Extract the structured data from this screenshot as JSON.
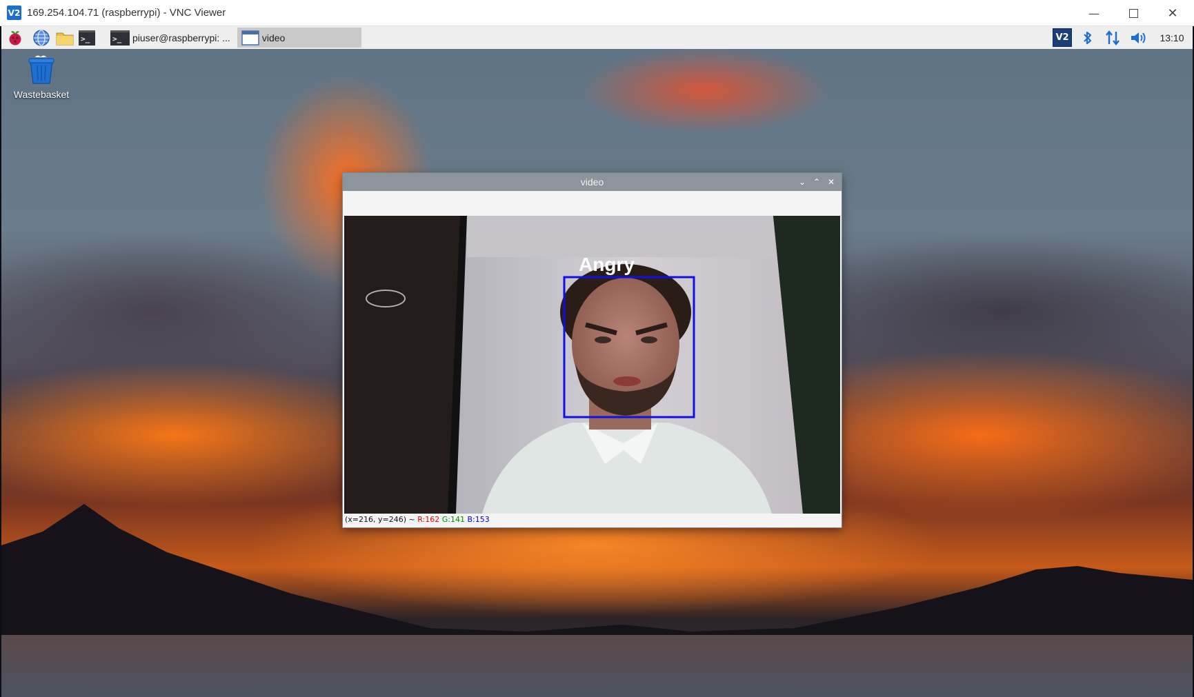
{
  "vnc": {
    "logo": "V2",
    "title": "169.254.104.71 (raspberrypi) - VNC Viewer",
    "minimize_icon": "minimize-icon",
    "maximize_icon": "maximize-icon",
    "close_icon": "close-icon"
  },
  "panel": {
    "launchers": [
      "raspberry-menu-icon",
      "web-browser-icon",
      "file-manager-icon",
      "terminal-icon"
    ],
    "terminal_glyph": ">_",
    "tasks": [
      {
        "label": "piuser@raspberrypi: ...",
        "icon": "terminal-icon",
        "active": false
      },
      {
        "label": "video",
        "icon": "window-icon",
        "active": true
      }
    ],
    "tray": [
      "vnc-server-icon",
      "bluetooth-icon",
      "network-icon",
      "volume-icon"
    ],
    "vnc_tray_text": "V2",
    "clock": "13:10"
  },
  "desktop": {
    "icons": [
      {
        "label": "Wastebasket",
        "icon": "trash-icon"
      }
    ]
  },
  "video_window": {
    "title": "video",
    "detection": {
      "label": "Angry",
      "box_color": "#1010e0",
      "label_color": "#ffffff"
    },
    "status": {
      "coords": "(x=216, y=246) ~",
      "r": "R:162",
      "g": "G:141",
      "b": "B:153"
    }
  },
  "colors": {
    "status_r": "#e00000",
    "status_g": "#008800",
    "status_b": "#0000d0",
    "accent": "#1c6fd1"
  }
}
